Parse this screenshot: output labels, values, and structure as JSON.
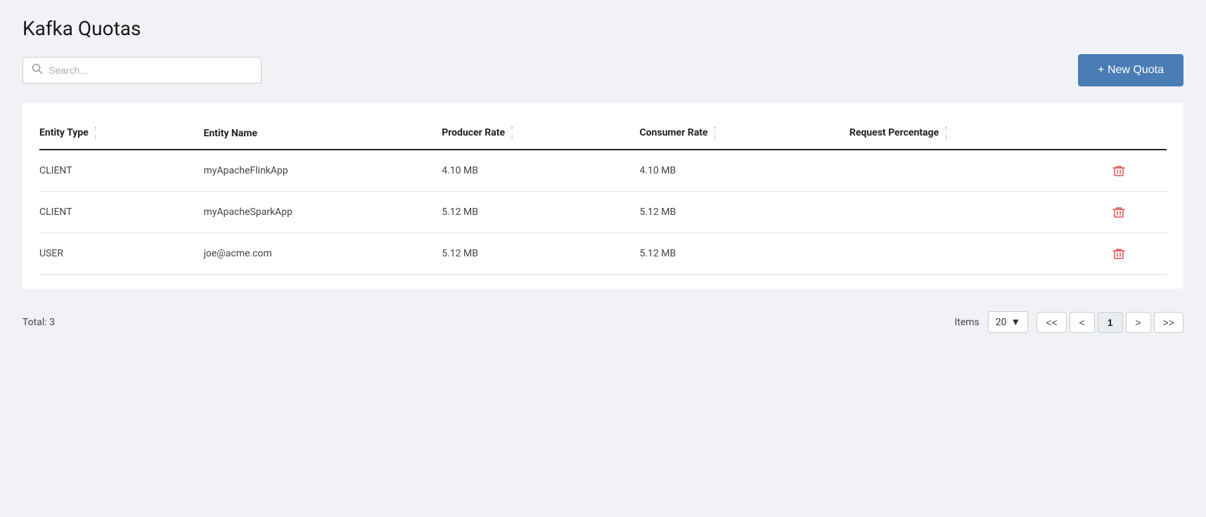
{
  "page": {
    "title": "Kafka Quotas"
  },
  "toolbar": {
    "search_placeholder": "Search...",
    "new_quota_label": "+ New Quota"
  },
  "table": {
    "columns": [
      {
        "key": "entity_type",
        "label": "Entity Type",
        "sortable": true
      },
      {
        "key": "entity_name",
        "label": "Entity Name",
        "sortable": false
      },
      {
        "key": "producer_rate",
        "label": "Producer Rate",
        "sortable": true
      },
      {
        "key": "consumer_rate",
        "label": "Consumer Rate",
        "sortable": true
      },
      {
        "key": "request_percentage",
        "label": "Request Percentage",
        "sortable": true
      }
    ],
    "rows": [
      {
        "entity_type": "CLIENT",
        "entity_name": "myApacheFlinkApp",
        "producer_rate": "4.10 MB",
        "consumer_rate": "4.10 MB",
        "request_percentage": ""
      },
      {
        "entity_type": "CLIENT",
        "entity_name": "myApacheSparkApp",
        "producer_rate": "5.12 MB",
        "consumer_rate": "5.12 MB",
        "request_percentage": ""
      },
      {
        "entity_type": "USER",
        "entity_name": "joe@acme.com",
        "producer_rate": "5.12 MB",
        "consumer_rate": "5.12 MB",
        "request_percentage": ""
      }
    ]
  },
  "footer": {
    "total_label": "Total: 3",
    "items_label": "Items",
    "items_per_page": "20",
    "current_page": "1",
    "pagination_buttons": [
      "<<",
      "<",
      "1",
      ">",
      ">>"
    ]
  }
}
